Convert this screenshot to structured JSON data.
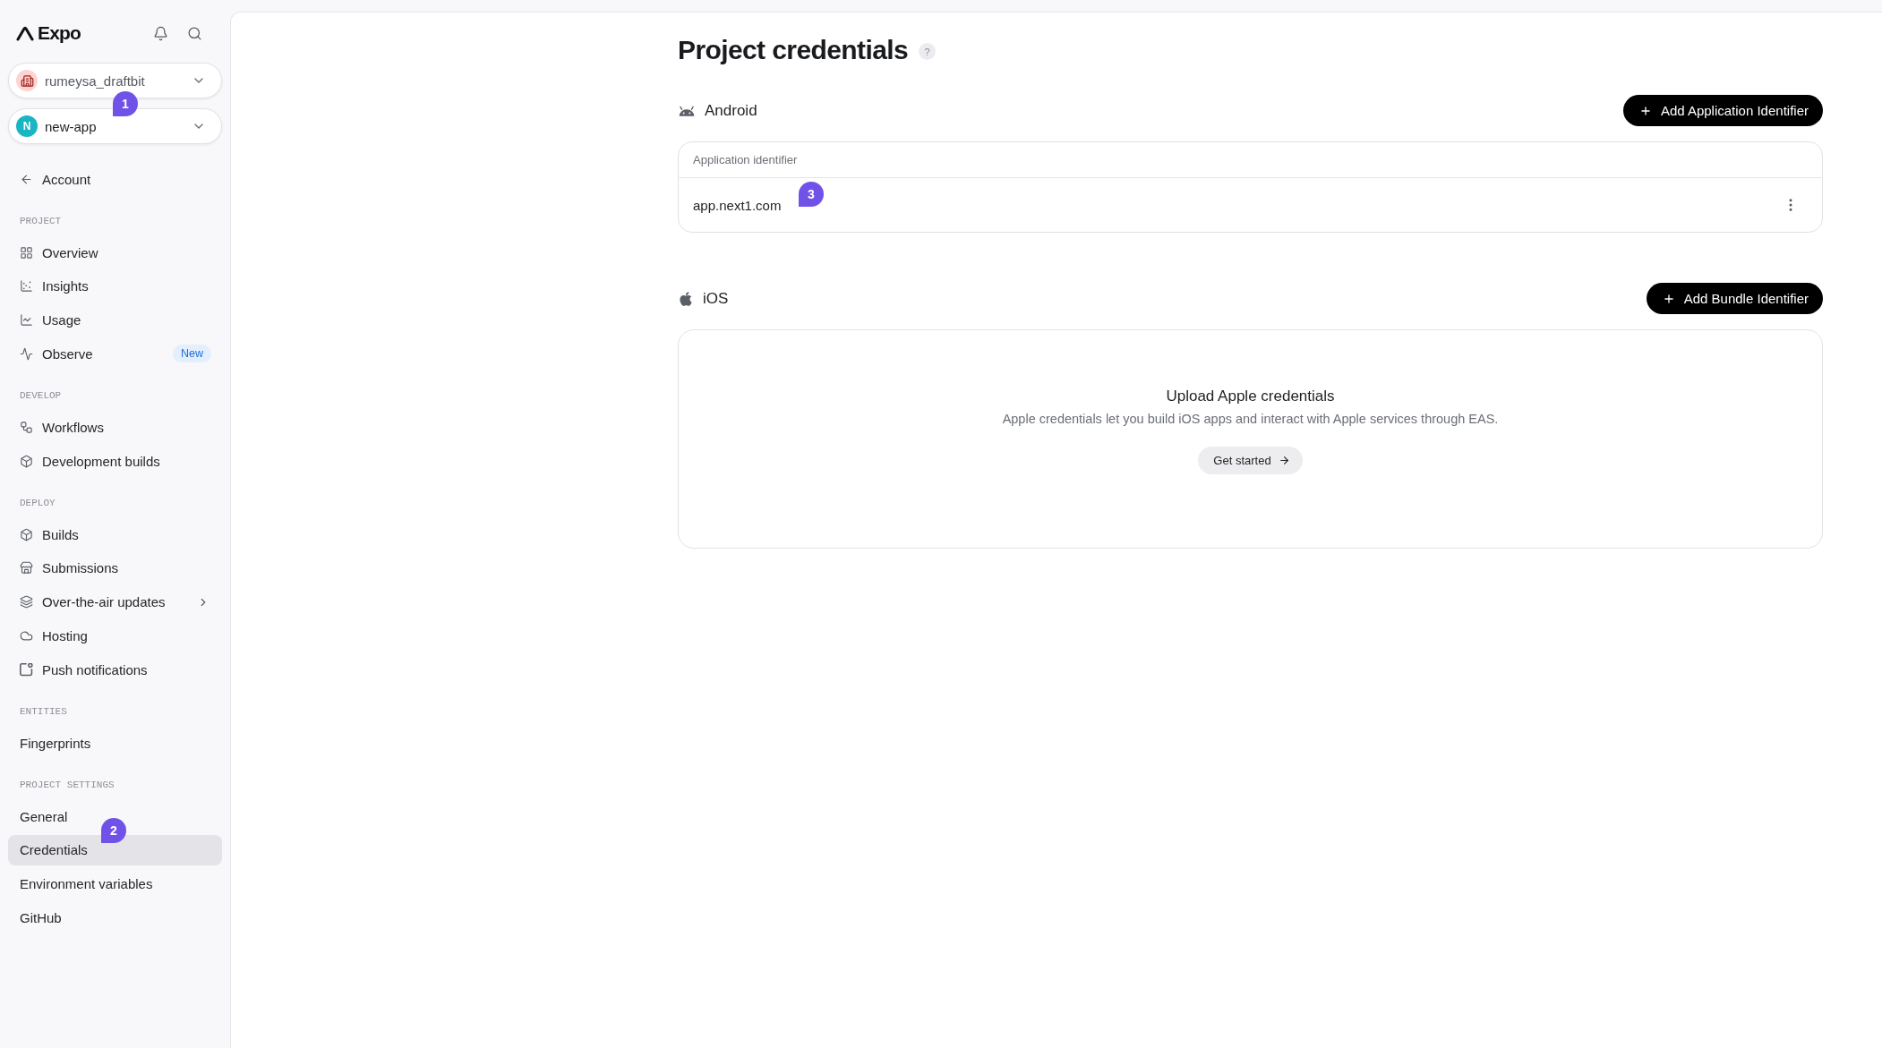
{
  "sidebar": {
    "logo": {
      "text": "Expo"
    },
    "team_switcher": {
      "label": "rumeysa_draftbit"
    },
    "project_switcher": {
      "avatar_letter": "N",
      "label": "new-app",
      "callout": "1"
    },
    "back_link": {
      "label": "Account"
    },
    "sections": [
      {
        "title": "PROJECT",
        "items": [
          {
            "label": "Overview",
            "selected": false
          },
          {
            "label": "Insights",
            "selected": false
          },
          {
            "label": "Usage",
            "selected": false
          },
          {
            "label": "Observe",
            "selected": false,
            "badge": "New"
          }
        ]
      },
      {
        "title": "DEVELOP",
        "items": [
          {
            "label": "Workflows",
            "selected": false
          },
          {
            "label": "Development builds",
            "selected": false
          }
        ]
      },
      {
        "title": "DEPLOY",
        "items": [
          {
            "label": "Builds",
            "selected": false
          },
          {
            "label": "Submissions",
            "selected": false
          },
          {
            "label": "Over-the-air updates",
            "selected": false,
            "expanded": false
          },
          {
            "label": "Hosting",
            "selected": false
          },
          {
            "label": "Push notifications",
            "selected": false
          }
        ]
      },
      {
        "title": "ENTITIES",
        "items": [
          {
            "label": "Fingerprints",
            "selected": false
          }
        ]
      },
      {
        "title": "PROJECT SETTINGS",
        "items": [
          {
            "label": "General",
            "selected": false
          },
          {
            "label": "Credentials",
            "selected": true,
            "callout": "2"
          },
          {
            "label": "Environment variables",
            "selected": false
          },
          {
            "label": "GitHub",
            "selected": false
          }
        ]
      }
    ]
  },
  "page": {
    "title": "Project credentials",
    "help": "?"
  },
  "platforms": [
    {
      "kind": "android",
      "name": "Android",
      "action": "Add Application Identifier",
      "table": {
        "columns": [
          "Application identifier"
        ],
        "rows": [
          {
            "cells": [
              "app.next1.com"
            ],
            "callout": "3"
          }
        ]
      }
    },
    {
      "kind": "ios",
      "name": "iOS",
      "action": "Add Bundle Identifier",
      "empty_state": {
        "title": "Upload Apple credentials",
        "description": "Apple credentials let you build iOS apps and interact with Apple services through EAS.",
        "button": "Get started"
      }
    }
  ]
}
